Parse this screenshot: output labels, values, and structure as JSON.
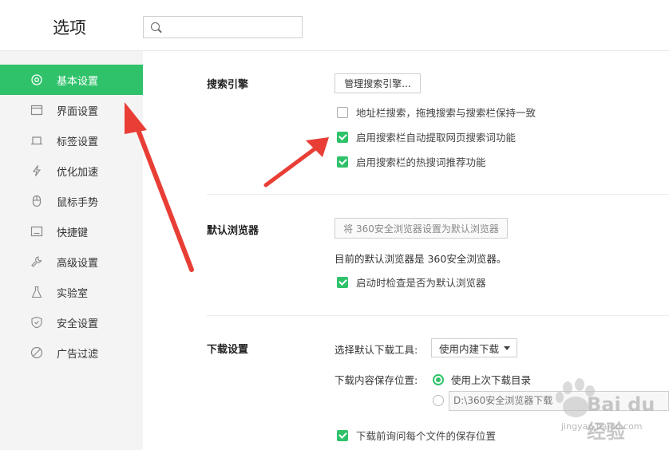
{
  "header": {
    "title": "选项",
    "search_placeholder": ""
  },
  "sidebar": {
    "items": [
      {
        "label": "基本设置",
        "icon": "gear-icon",
        "active": true
      },
      {
        "label": "界面设置",
        "icon": "window-icon"
      },
      {
        "label": "标签设置",
        "icon": "tab-icon"
      },
      {
        "label": "优化加速",
        "icon": "lightning-icon"
      },
      {
        "label": "鼠标手势",
        "icon": "mouse-icon"
      },
      {
        "label": "快捷键",
        "icon": "keyboard-icon"
      },
      {
        "label": "高级设置",
        "icon": "wrench-icon"
      },
      {
        "label": "实验室",
        "icon": "flask-icon"
      },
      {
        "label": "安全设置",
        "icon": "shield-icon"
      },
      {
        "label": "广告过滤",
        "icon": "block-icon"
      }
    ]
  },
  "search_engine": {
    "title": "搜索引擎",
    "manage_button": "管理搜索引擎...",
    "options": [
      {
        "label": "地址栏搜索，拖拽搜索与搜索栏保持一致",
        "checked": false
      },
      {
        "label": "启用搜索栏自动提取网页搜索词功能",
        "checked": true
      },
      {
        "label": "启用搜索栏的热搜词推荐功能",
        "checked": true
      }
    ]
  },
  "default_browser": {
    "title": "默认浏览器",
    "set_button": "将 360安全浏览器设置为默认浏览器",
    "status": "目前的默认浏览器是 360安全浏览器。",
    "check_on_start": {
      "label": "启动时检查是否为默认浏览器",
      "checked": true
    }
  },
  "download": {
    "title": "下载设置",
    "tool_label": "选择默认下载工具:",
    "tool_value": "使用内建下载",
    "location_label": "下载内容保存位置:",
    "radio_last": {
      "label": "使用上次下载目录",
      "selected": true
    },
    "radio_custom": {
      "selected": false
    },
    "path_value": "D:\\360安全浏览器下载",
    "ask_each": {
      "label": "下载前询问每个文件的保存位置",
      "checked": true
    }
  },
  "watermark": {
    "text": "Bai du 经验",
    "url": "jingyan.baidu.com"
  },
  "colors": {
    "accent": "#2fc26a",
    "arrow": "#e83e36"
  }
}
